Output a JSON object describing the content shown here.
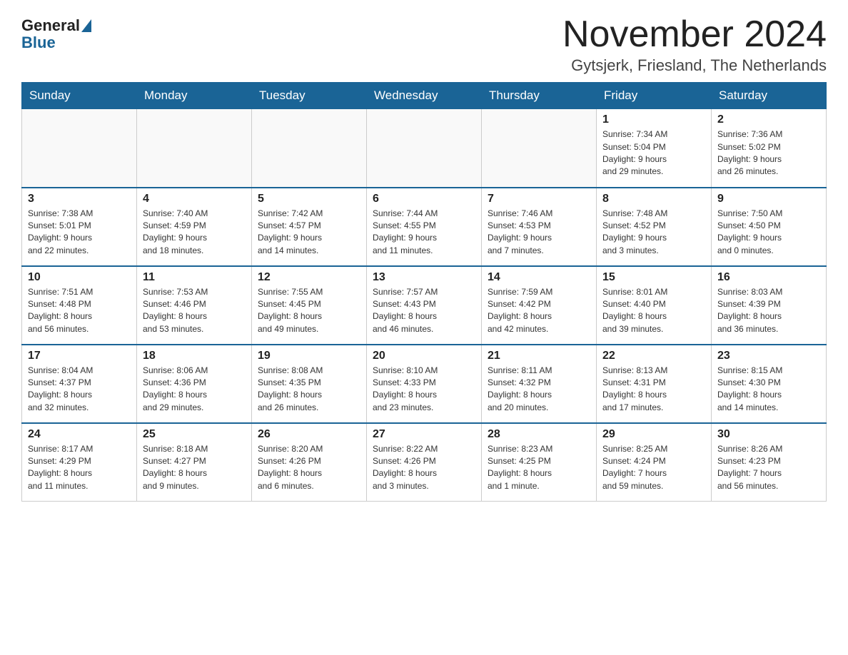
{
  "logo": {
    "general": "General",
    "blue": "Blue"
  },
  "title": "November 2024",
  "location": "Gytsjerk, Friesland, The Netherlands",
  "weekdays": [
    "Sunday",
    "Monday",
    "Tuesday",
    "Wednesday",
    "Thursday",
    "Friday",
    "Saturday"
  ],
  "weeks": [
    [
      {
        "day": "",
        "info": ""
      },
      {
        "day": "",
        "info": ""
      },
      {
        "day": "",
        "info": ""
      },
      {
        "day": "",
        "info": ""
      },
      {
        "day": "",
        "info": ""
      },
      {
        "day": "1",
        "info": "Sunrise: 7:34 AM\nSunset: 5:04 PM\nDaylight: 9 hours\nand 29 minutes."
      },
      {
        "day": "2",
        "info": "Sunrise: 7:36 AM\nSunset: 5:02 PM\nDaylight: 9 hours\nand 26 minutes."
      }
    ],
    [
      {
        "day": "3",
        "info": "Sunrise: 7:38 AM\nSunset: 5:01 PM\nDaylight: 9 hours\nand 22 minutes."
      },
      {
        "day": "4",
        "info": "Sunrise: 7:40 AM\nSunset: 4:59 PM\nDaylight: 9 hours\nand 18 minutes."
      },
      {
        "day": "5",
        "info": "Sunrise: 7:42 AM\nSunset: 4:57 PM\nDaylight: 9 hours\nand 14 minutes."
      },
      {
        "day": "6",
        "info": "Sunrise: 7:44 AM\nSunset: 4:55 PM\nDaylight: 9 hours\nand 11 minutes."
      },
      {
        "day": "7",
        "info": "Sunrise: 7:46 AM\nSunset: 4:53 PM\nDaylight: 9 hours\nand 7 minutes."
      },
      {
        "day": "8",
        "info": "Sunrise: 7:48 AM\nSunset: 4:52 PM\nDaylight: 9 hours\nand 3 minutes."
      },
      {
        "day": "9",
        "info": "Sunrise: 7:50 AM\nSunset: 4:50 PM\nDaylight: 9 hours\nand 0 minutes."
      }
    ],
    [
      {
        "day": "10",
        "info": "Sunrise: 7:51 AM\nSunset: 4:48 PM\nDaylight: 8 hours\nand 56 minutes."
      },
      {
        "day": "11",
        "info": "Sunrise: 7:53 AM\nSunset: 4:46 PM\nDaylight: 8 hours\nand 53 minutes."
      },
      {
        "day": "12",
        "info": "Sunrise: 7:55 AM\nSunset: 4:45 PM\nDaylight: 8 hours\nand 49 minutes."
      },
      {
        "day": "13",
        "info": "Sunrise: 7:57 AM\nSunset: 4:43 PM\nDaylight: 8 hours\nand 46 minutes."
      },
      {
        "day": "14",
        "info": "Sunrise: 7:59 AM\nSunset: 4:42 PM\nDaylight: 8 hours\nand 42 minutes."
      },
      {
        "day": "15",
        "info": "Sunrise: 8:01 AM\nSunset: 4:40 PM\nDaylight: 8 hours\nand 39 minutes."
      },
      {
        "day": "16",
        "info": "Sunrise: 8:03 AM\nSunset: 4:39 PM\nDaylight: 8 hours\nand 36 minutes."
      }
    ],
    [
      {
        "day": "17",
        "info": "Sunrise: 8:04 AM\nSunset: 4:37 PM\nDaylight: 8 hours\nand 32 minutes."
      },
      {
        "day": "18",
        "info": "Sunrise: 8:06 AM\nSunset: 4:36 PM\nDaylight: 8 hours\nand 29 minutes."
      },
      {
        "day": "19",
        "info": "Sunrise: 8:08 AM\nSunset: 4:35 PM\nDaylight: 8 hours\nand 26 minutes."
      },
      {
        "day": "20",
        "info": "Sunrise: 8:10 AM\nSunset: 4:33 PM\nDaylight: 8 hours\nand 23 minutes."
      },
      {
        "day": "21",
        "info": "Sunrise: 8:11 AM\nSunset: 4:32 PM\nDaylight: 8 hours\nand 20 minutes."
      },
      {
        "day": "22",
        "info": "Sunrise: 8:13 AM\nSunset: 4:31 PM\nDaylight: 8 hours\nand 17 minutes."
      },
      {
        "day": "23",
        "info": "Sunrise: 8:15 AM\nSunset: 4:30 PM\nDaylight: 8 hours\nand 14 minutes."
      }
    ],
    [
      {
        "day": "24",
        "info": "Sunrise: 8:17 AM\nSunset: 4:29 PM\nDaylight: 8 hours\nand 11 minutes."
      },
      {
        "day": "25",
        "info": "Sunrise: 8:18 AM\nSunset: 4:27 PM\nDaylight: 8 hours\nand 9 minutes."
      },
      {
        "day": "26",
        "info": "Sunrise: 8:20 AM\nSunset: 4:26 PM\nDaylight: 8 hours\nand 6 minutes."
      },
      {
        "day": "27",
        "info": "Sunrise: 8:22 AM\nSunset: 4:26 PM\nDaylight: 8 hours\nand 3 minutes."
      },
      {
        "day": "28",
        "info": "Sunrise: 8:23 AM\nSunset: 4:25 PM\nDaylight: 8 hours\nand 1 minute."
      },
      {
        "day": "29",
        "info": "Sunrise: 8:25 AM\nSunset: 4:24 PM\nDaylight: 7 hours\nand 59 minutes."
      },
      {
        "day": "30",
        "info": "Sunrise: 8:26 AM\nSunset: 4:23 PM\nDaylight: 7 hours\nand 56 minutes."
      }
    ]
  ]
}
